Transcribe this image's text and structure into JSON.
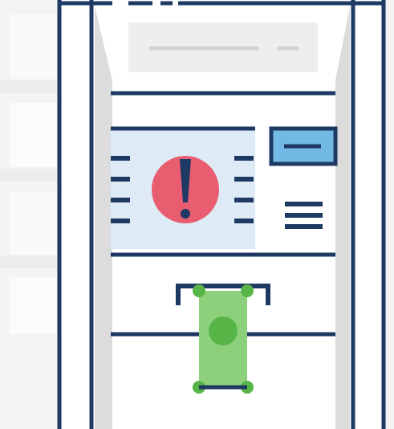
{
  "illustration": {
    "subject": "atm-machine-with-error",
    "icons": {
      "atm": "atm-machine-icon",
      "error": "exclamation-alert-icon",
      "card_slot": "card-slot-icon",
      "cash": "banknote-icon"
    },
    "colors": {
      "background": "#f4f4f4",
      "outline": "#1e3a64",
      "panel_shadow": "#dcdcdc",
      "screen": "#deebf6",
      "alert": "#e85d70",
      "card_slot": "#72b9e4",
      "banknote": "#8cd07c",
      "banknote_circle": "#57b447"
    }
  }
}
